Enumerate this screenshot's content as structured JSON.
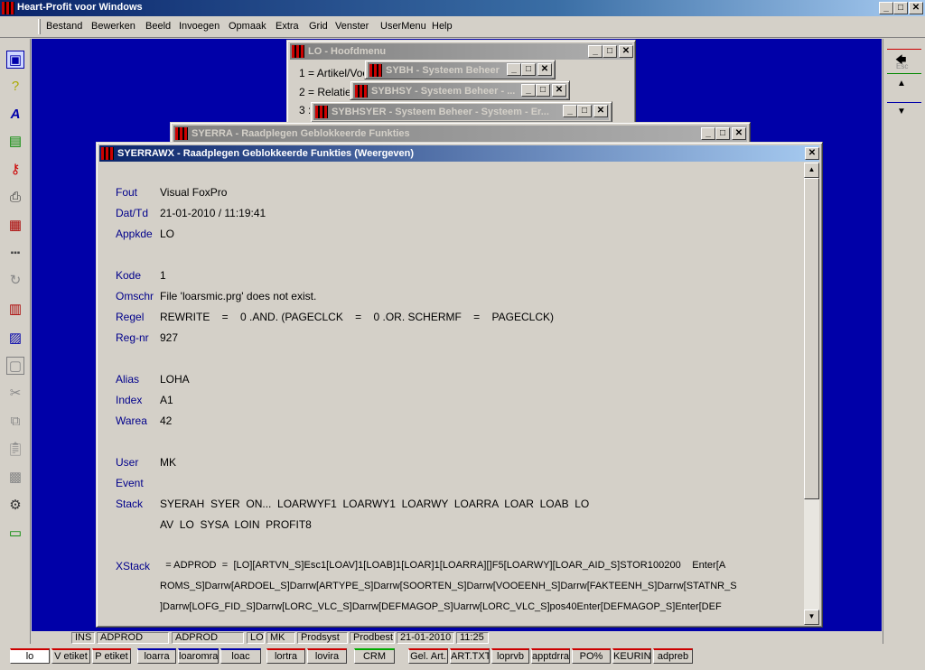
{
  "app": {
    "title": "Heart-Profit voor Windows"
  },
  "titlebar": {
    "min": "_",
    "max": "□",
    "close": "✕"
  },
  "menu": [
    "Bestand",
    "Bewerken",
    "Beeld",
    "Invoegen",
    "Opmaak",
    "Extra",
    "Grid",
    "Venster",
    "UserMenu",
    "Help"
  ],
  "windows": {
    "lo": {
      "title": "LO - Hoofdmenu",
      "items": [
        "1 = Artikel/Voo",
        "2 = Relatie",
        "3 :"
      ]
    },
    "sybh": {
      "title": "SYBH - Systeem Beheer"
    },
    "sybhsy": {
      "title": "SYBHSY - Systeem Beheer - ..."
    },
    "sybhsyer": {
      "title": "SYBHSYER - Systeem Beheer - Systeem - Er..."
    },
    "syerra": {
      "title": "SYERRA - Raadplegen Geblokkeerde Funkties"
    },
    "syerrawx": {
      "title": "SYERRAWX - Raadplegen Geblokkeerde Funkties (Weergeven)"
    }
  },
  "detail": {
    "fout_label": "Fout",
    "fout": "Visual FoxPro",
    "dattd_label": "Dat/Td",
    "dattd": "21-01-2010 / 11:19:41",
    "appkde_label": "Appkde",
    "appkde": "LO",
    "kode_label": "Kode",
    "kode": "1",
    "omschr_label": "Omschr",
    "omschr": "File 'loarsmic.prg' does not exist.",
    "regel_label": "Regel",
    "regel": "REWRITE    =    0 .AND. (PAGECLCK    =    0 .OR. SCHERMF    =    PAGECLCK)",
    "regnr_label": "Reg-nr",
    "regnr": "927",
    "alias_label": "Alias",
    "alias": "LOHA",
    "index_label": "Index",
    "index": "A1",
    "warea_label": "Warea",
    "warea": "42",
    "user_label": "User",
    "user": "MK",
    "event_label": "Event",
    "event": "",
    "stack_label": "Stack",
    "stack1": "SYERAH  SYER  ON...  LOARWYF1  LOARWY1  LOARWY  LOARRA  LOAR  LOAB  LO",
    "stack2": "AV  LO  SYSA  LOIN  PROFIT8",
    "xstack_label": "XStack",
    "xstack1": "  = ADPROD  =  [LO][ARTVN_S]Esc1[LOAV]1[LOAB]1[LOAR]1[LOARRA][]F5[LOARWY][LOAR_AID_S]STOR100200    Enter[A",
    "xstack2": "ROMS_S]Darrw[ARDOEL_S]Darrw[ARTYPE_S]Darrw[SOORTEN_S]Darrw[VOOEENH_S]Darrw[FAKTEENH_S]Darrw[STATNR_S",
    "xstack3": "]Darrw[LOFG_FID_S]Darrw[LORC_VLC_S]Darrw[DEFMAGOP_S]Uarrw[LORC_VLC_S]pos40Enter[DEFMAGOP_S]Enter[DEF"
  },
  "right_toolbar": {
    "esc": "Esc"
  },
  "statusbar": [
    "INS",
    "ADPROD",
    "ADPROD",
    "LO",
    "MK",
    "Prodsyst",
    "Prodbest",
    "21-01-2010",
    "11:25"
  ],
  "tabs": [
    "lo",
    "V etiket",
    "P etiket",
    "loarra",
    "loaromra",
    "loac",
    "lortra",
    "lovira",
    "CRM",
    "Gel. Art.",
    "ART.TXT",
    "loprvb",
    "apptdrra",
    "PO%",
    "KEURING",
    "adpreb"
  ],
  "colors": {
    "desktop": "#0000a8",
    "label": "#00008b",
    "active_caption": "#0a246a"
  }
}
